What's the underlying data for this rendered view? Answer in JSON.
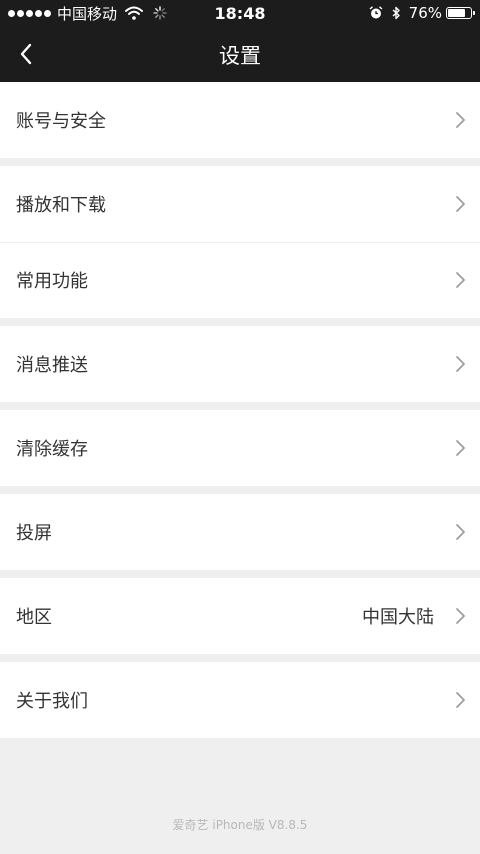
{
  "status_bar": {
    "carrier": "中国移动",
    "time": "18:48",
    "battery_percent": "76%",
    "battery_level": 0.76
  },
  "header": {
    "title": "设置",
    "back_icon": "chevron-left-icon"
  },
  "settings_groups": [
    {
      "items": [
        {
          "label": "账号与安全"
        }
      ]
    },
    {
      "items": [
        {
          "label": "播放和下载"
        },
        {
          "label": "常用功能"
        }
      ]
    },
    {
      "items": [
        {
          "label": "消息推送"
        }
      ]
    },
    {
      "items": [
        {
          "label": "清除缓存"
        }
      ]
    },
    {
      "items": [
        {
          "label": "投屏"
        }
      ]
    },
    {
      "items": [
        {
          "label": "地区",
          "value": "中国大陆"
        }
      ]
    },
    {
      "items": [
        {
          "label": "关于我们"
        }
      ]
    }
  ],
  "footer": {
    "version_text": "爱奇艺 iPhone版 V8.8.5"
  },
  "colors": {
    "header_bg": "#1c1c1c",
    "page_bg": "#efefef",
    "row_bg": "#ffffff",
    "text": "#333333",
    "chevron": "#9e9e9e",
    "footer_text": "#b8b8b8"
  }
}
